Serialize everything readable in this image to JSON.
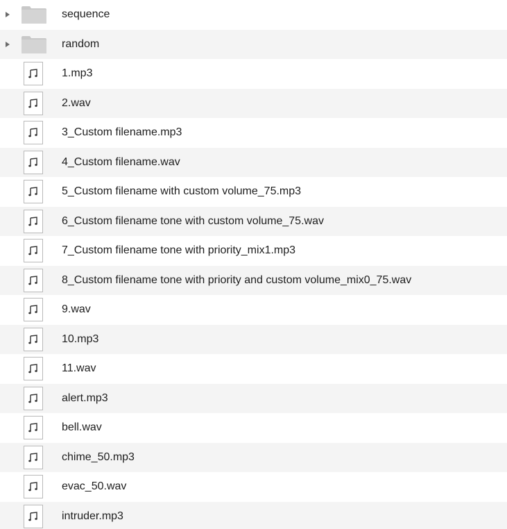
{
  "items": [
    {
      "type": "folder",
      "name": "sequence",
      "icon": "folder-icon"
    },
    {
      "type": "folder",
      "name": "random",
      "icon": "folder-icon"
    },
    {
      "type": "audio",
      "name": "1.mp3",
      "icon": "music-note-icon"
    },
    {
      "type": "audio",
      "name": "2.wav",
      "icon": "music-note-icon"
    },
    {
      "type": "audio",
      "name": "3_Custom filename.mp3",
      "icon": "music-note-icon"
    },
    {
      "type": "audio",
      "name": "4_Custom filename.wav",
      "icon": "music-note-icon"
    },
    {
      "type": "audio",
      "name": "5_Custom filename with custom volume_75.mp3",
      "icon": "music-note-icon"
    },
    {
      "type": "audio",
      "name": "6_Custom filename tone with custom volume_75.wav",
      "icon": "music-note-icon"
    },
    {
      "type": "audio",
      "name": "7_Custom filename tone with priority_mix1.mp3",
      "icon": "music-note-icon"
    },
    {
      "type": "audio",
      "name": "8_Custom filename tone with priority and custom volume_mix0_75.wav",
      "icon": "music-note-icon"
    },
    {
      "type": "audio",
      "name": "9.wav",
      "icon": "music-note-icon"
    },
    {
      "type": "audio",
      "name": "10.mp3",
      "icon": "music-note-icon"
    },
    {
      "type": "audio",
      "name": "11.wav",
      "icon": "music-note-icon"
    },
    {
      "type": "audio",
      "name": "alert.mp3",
      "icon": "music-note-icon"
    },
    {
      "type": "audio",
      "name": "bell.wav",
      "icon": "music-note-icon"
    },
    {
      "type": "audio",
      "name": "chime_50.mp3",
      "icon": "music-note-icon"
    },
    {
      "type": "audio",
      "name": "evac_50.wav",
      "icon": "music-note-icon"
    },
    {
      "type": "audio",
      "name": "intruder.mp3",
      "icon": "music-note-icon"
    }
  ]
}
